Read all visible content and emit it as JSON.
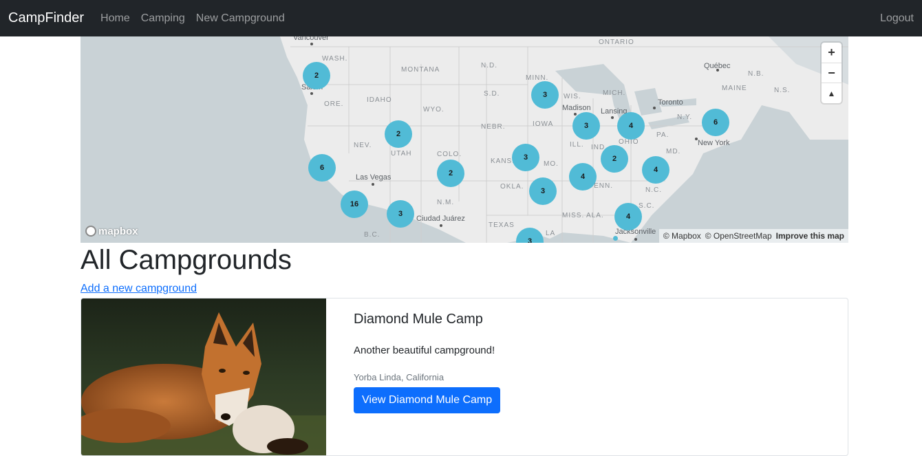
{
  "navbar": {
    "brand": "CampFinder",
    "links": [
      "Home",
      "Camping",
      "New Campground"
    ],
    "logout": "Logout"
  },
  "map": {
    "region_labels": [
      "WASH.",
      "MONTANA",
      "N.D.",
      "MINN.",
      "ONTARIO",
      "ORE.",
      "IDAHO",
      "S.D.",
      "WIS.",
      "MICH.",
      "WYO.",
      "NEBR.",
      "IOWA",
      "N.Y.",
      "NEV.",
      "UTAH",
      "COLO.",
      "KANS.",
      "MO.",
      "ILL.",
      "IND.",
      "OHIO",
      "PA.",
      "MD.",
      "N.M.",
      "OKLA.",
      "TENN.",
      "N.C.",
      "TEXAS",
      "MISS.",
      "ALA.",
      "S.C.",
      "LA",
      "N.B.",
      "MAINE",
      "N.S.",
      "B.C."
    ],
    "cities": [
      "Vancouver",
      "Salem",
      "Las Vegas",
      "Ciudad Juárez",
      "Madison",
      "Lansing",
      "Toronto",
      "Québec",
      "New York",
      "Jacksonville"
    ],
    "clusters": [
      "2",
      "3",
      "3",
      "4",
      "6",
      "2",
      "2",
      "3",
      "6",
      "2",
      "4",
      "4",
      "3",
      "16",
      "3",
      "4",
      "3"
    ],
    "controls": {
      "zoom_in": "+",
      "zoom_out": "−",
      "compass": "▲"
    },
    "logo": "mapbox",
    "attribution": [
      "© Mapbox",
      "© OpenStreetMap",
      "Improve this map"
    ]
  },
  "page": {
    "title": "All Campgrounds",
    "add_link": "Add a new campground"
  },
  "campgrounds": [
    {
      "title": "Diamond Mule Camp",
      "description": "Another beautiful campground!",
      "location": "Yorba Linda, California",
      "button": "View Diamond Mule Camp"
    }
  ],
  "colors": {
    "navbar_bg": "#212529",
    "cluster": "#51bbd6",
    "primary": "#0d6efd",
    "water": "#c9d2d6",
    "land": "#ececec"
  }
}
